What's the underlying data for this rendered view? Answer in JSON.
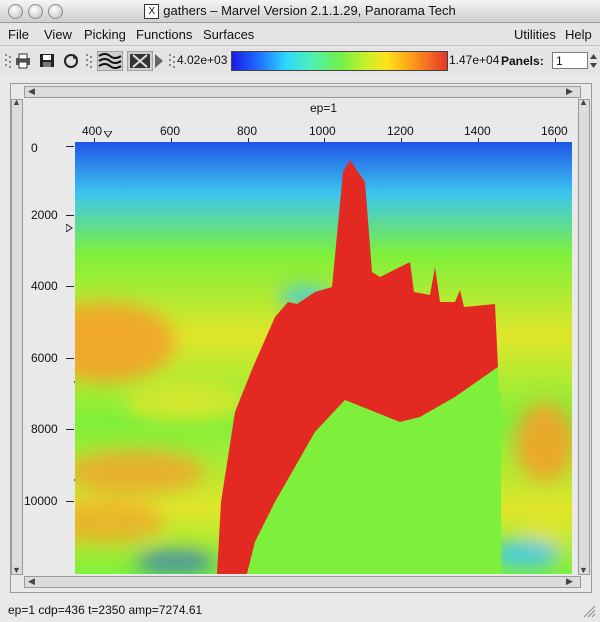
{
  "window": {
    "title": "gathers – Marvel Version 2.1.1.29, Panorama Tech",
    "x_icon": "X"
  },
  "menu": {
    "file": "File",
    "view": "View",
    "picking": "Picking",
    "functions": "Functions",
    "surfaces": "Surfaces",
    "utilities": "Utilities",
    "help": "Help"
  },
  "toolbar": {
    "icons": [
      "print-icon",
      "save-icon",
      "refresh-icon",
      "wiggle-display-icon",
      "variable-area-icon",
      "play-icon"
    ],
    "colorbar_min": "4.02e+03",
    "colorbar_max": "1.47e+04",
    "panels_label": "Panels:",
    "panels_value": "1"
  },
  "plot": {
    "header": "ep=1",
    "x_ticks": [
      "400",
      "600",
      "800",
      "1000",
      "1200",
      "1400",
      "1600"
    ],
    "y_ticks": [
      "0",
      "2000",
      "4000",
      "6000",
      "8000",
      "10000"
    ],
    "colors": {
      "blue": "#1f55e6",
      "cyan": "#3cc6ef",
      "green": "#7ef03b",
      "yellow": "#e0e62a",
      "orange": "#f2a22a",
      "red": "#e22a22"
    }
  },
  "status": {
    "text": "ep=1  cdp=436 t=2350 amp=7274.61"
  }
}
